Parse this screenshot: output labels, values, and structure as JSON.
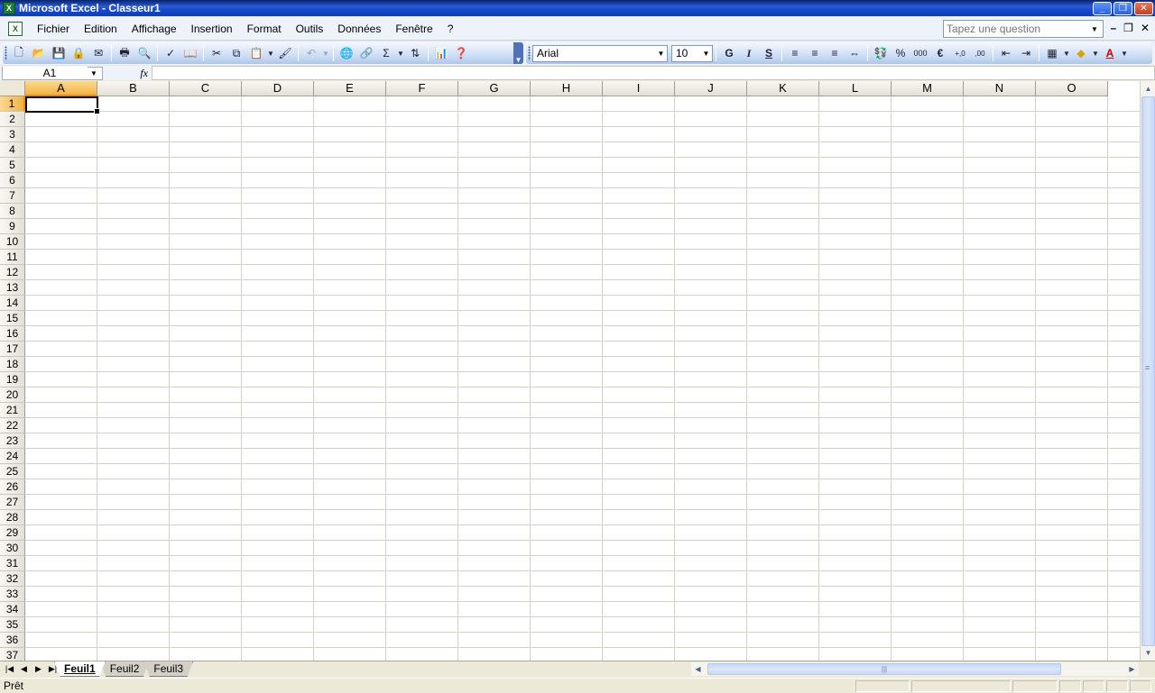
{
  "window": {
    "title": "Microsoft Excel - Classeur1"
  },
  "menu": {
    "items": [
      {
        "label": "Fichier"
      },
      {
        "label": "Edition"
      },
      {
        "label": "Affichage"
      },
      {
        "label": "Insertion"
      },
      {
        "label": "Format"
      },
      {
        "label": "Outils"
      },
      {
        "label": "Données"
      },
      {
        "label": "Fenêtre"
      },
      {
        "label": "?"
      }
    ],
    "question_placeholder": "Tapez une question"
  },
  "formatting": {
    "font": "Arial",
    "size": "10",
    "bold": "G",
    "italic": "I",
    "underline": "S"
  },
  "formula_bar": {
    "name_box": "A1",
    "fx": "fx",
    "formula": ""
  },
  "columns": [
    "A",
    "B",
    "C",
    "D",
    "E",
    "F",
    "G",
    "H",
    "I",
    "J",
    "K",
    "L",
    "M",
    "N",
    "O"
  ],
  "rows": [
    "1",
    "2",
    "3",
    "4",
    "5",
    "6",
    "7",
    "8",
    "9",
    "10",
    "11",
    "12",
    "13",
    "14",
    "15",
    "16",
    "17",
    "18",
    "19",
    "20",
    "21",
    "22",
    "23",
    "24",
    "25",
    "26",
    "27",
    "28",
    "29",
    "30",
    "31",
    "32",
    "33",
    "34",
    "35",
    "36",
    "37"
  ],
  "active_cell": {
    "column": "A",
    "row": "1"
  },
  "sheets": [
    {
      "label": "Feuil1",
      "active": true
    },
    {
      "label": "Feuil2",
      "active": false
    },
    {
      "label": "Feuil3",
      "active": false
    }
  ],
  "status": {
    "text": "Prêt"
  },
  "colors": {
    "title_bar": "#0b3fb6",
    "toolbar": "#c8d9f3",
    "active_header": "#f3b344"
  }
}
